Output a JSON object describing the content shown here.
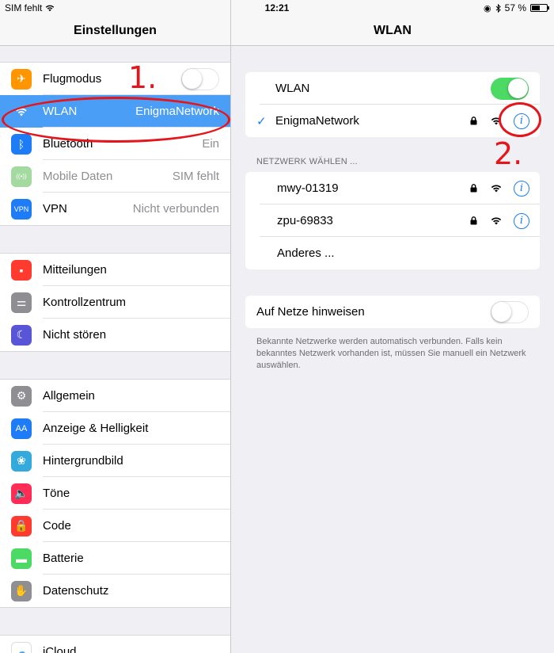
{
  "status_bar": {
    "carrier": "SIM fehlt",
    "time": "12:21",
    "battery": "57 %",
    "battery_level": 0.57
  },
  "left_nav": {
    "title": "Einstellungen"
  },
  "settings_groups": [
    [
      {
        "key": "flugmodus",
        "label": "Flugmodus",
        "icon": "airplane-icon",
        "icon_color": "#ff9500",
        "toggle": "off"
      },
      {
        "key": "wlan",
        "label": "WLAN",
        "value": "EnigmaNetwork",
        "icon": "wifi-icon",
        "icon_color": "#1e7cf6",
        "selected": true
      },
      {
        "key": "bluetooth",
        "label": "Bluetooth",
        "value": "Ein",
        "icon": "bluetooth-icon",
        "icon_color": "#1e7cf6"
      },
      {
        "key": "mobile-daten",
        "label": "Mobile Daten",
        "value": "SIM fehlt",
        "icon": "antenna-icon",
        "icon_color": "#a4d9a0",
        "disabled": true
      },
      {
        "key": "vpn",
        "label": "VPN",
        "value": "Nicht verbunden",
        "icon": "vpn-icon",
        "icon_color": "#1e7cf6",
        "icon_text": "VPN"
      }
    ],
    [
      {
        "key": "mitteilungen",
        "label": "Mitteilungen",
        "icon": "notifications-icon",
        "icon_color": "#ff3b30"
      },
      {
        "key": "kontrollzentrum",
        "label": "Kontrollzentrum",
        "icon": "switches-icon",
        "icon_color": "#8e8e93"
      },
      {
        "key": "nicht-stoeren",
        "label": "Nicht stören",
        "icon": "moon-icon",
        "icon_color": "#5856d6"
      }
    ],
    [
      {
        "key": "allgemein",
        "label": "Allgemein",
        "icon": "gear-icon",
        "icon_color": "#8e8e93"
      },
      {
        "key": "anzeige",
        "label": "Anzeige & Helligkeit",
        "icon": "text-size-icon",
        "icon_color": "#1e7cf6",
        "icon_text": "AA"
      },
      {
        "key": "hintergrundbild",
        "label": "Hintergrundbild",
        "icon": "flower-icon",
        "icon_color": "#34aadc"
      },
      {
        "key": "toene",
        "label": "Töne",
        "icon": "speaker-icon",
        "icon_color": "#ff2d55"
      },
      {
        "key": "code",
        "label": "Code",
        "icon": "lock-icon",
        "icon_color": "#ff3b30"
      },
      {
        "key": "batterie",
        "label": "Batterie",
        "icon": "battery-icon",
        "icon_color": "#4cd964"
      },
      {
        "key": "datenschutz",
        "label": "Datenschutz",
        "icon": "hand-icon",
        "icon_color": "#8e8e93"
      }
    ],
    [
      {
        "key": "icloud",
        "label": "iCloud",
        "icon": "cloud-icon",
        "icon_color": "#ffffff"
      }
    ]
  ],
  "wlan_panel": {
    "title": "WLAN",
    "wlan_label": "WLAN",
    "wlan_toggle": "on",
    "connected_network": "EnigmaNetwork",
    "choose_header": "NETZWERK WÄHLEN ...",
    "networks": [
      {
        "name": "mwy-01319",
        "secured": true
      },
      {
        "name": "zpu-69833",
        "secured": true
      }
    ],
    "other_label": "Anderes ...",
    "ask_label": "Auf Netze hinweisen",
    "ask_toggle": "off",
    "footnote": "Bekannte Netzwerke werden automatisch verbunden. Falls kein bekanntes Netzwerk vorhanden ist, müssen Sie manuell ein Netzwerk auswählen."
  },
  "annotations": {
    "step1": "1.",
    "step2": "2."
  },
  "colors": {
    "accent": "#1a7cf5",
    "selection": "#4a9ef5",
    "annotation": "#e4161b",
    "switch_on": "#4cd964"
  }
}
